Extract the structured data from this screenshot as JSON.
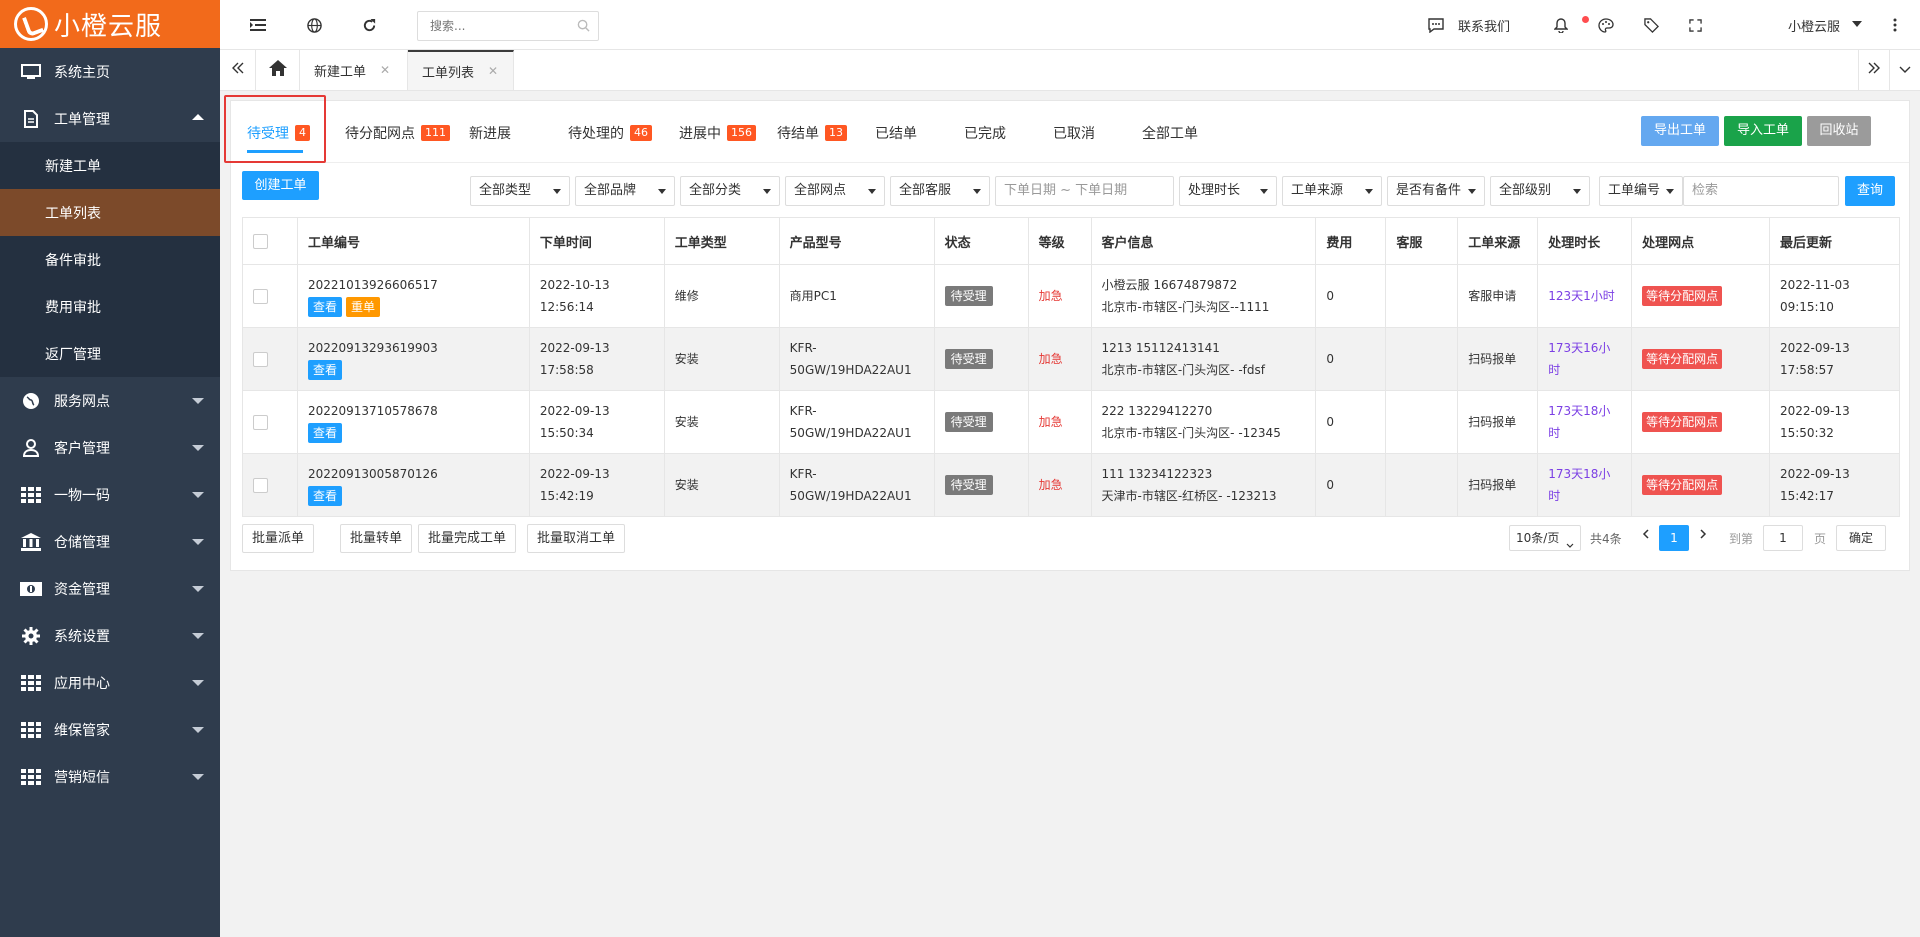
{
  "app": {
    "brand": "小橙云服"
  },
  "sidebar": {
    "items": [
      {
        "label": "系统主页",
        "icon": "monitor-icon"
      },
      {
        "label": "工单管理",
        "icon": "document-icon",
        "open": true,
        "children": [
          "新建工单",
          "工单列表",
          "备件审批",
          "费用审批",
          "返厂管理"
        ],
        "active_child": "工单列表"
      },
      {
        "label": "服务网点",
        "icon": "globe-icon"
      },
      {
        "label": "客户管理",
        "icon": "user-icon"
      },
      {
        "label": "一物一码",
        "icon": "grid-icon"
      },
      {
        "label": "仓储管理",
        "icon": "bank-icon"
      },
      {
        "label": "资金管理",
        "icon": "money-icon"
      },
      {
        "label": "系统设置",
        "icon": "gear-icon"
      },
      {
        "label": "应用中心",
        "icon": "grid-icon"
      },
      {
        "label": "维保管家",
        "icon": "grid-icon"
      },
      {
        "label": "营销短信",
        "icon": "grid-icon"
      }
    ]
  },
  "topbar": {
    "search_placeholder": "搜索...",
    "contact": "联系我们",
    "user": "小橙云服"
  },
  "page_tabs": [
    {
      "label": "新建工单"
    },
    {
      "label": "工单列表",
      "active": true
    }
  ],
  "status_tabs": [
    {
      "label": "待受理",
      "badge": "4",
      "active": true
    },
    {
      "label": "待分配网点",
      "badge": "111"
    },
    {
      "label": "新进展",
      "badge": ""
    },
    {
      "label": "待处理的",
      "badge": "46"
    },
    {
      "label": "进展中",
      "badge": "156"
    },
    {
      "label": "待结单",
      "badge": "13"
    },
    {
      "label": "已结单",
      "badge": ""
    },
    {
      "label": "已完成",
      "badge": ""
    },
    {
      "label": "已取消",
      "badge": ""
    },
    {
      "label": "全部工单",
      "badge": ""
    }
  ],
  "actions": {
    "export": "导出工单",
    "import": "导入工单",
    "recycle": "回收站",
    "create": "创建工单",
    "query": "查询"
  },
  "filters": {
    "type": "全部类型",
    "brand": "全部品牌",
    "category": "全部分类",
    "outlet": "全部网点",
    "service": "全部客服",
    "date_placeholder": "下单日期 ~ 下单日期",
    "duration": "处理时长",
    "source": "工单来源",
    "spare": "是否有备件",
    "level": "全部级别",
    "field": "工单编号",
    "keyword_placeholder": "检索"
  },
  "table": {
    "columns": [
      "工单编号",
      "下单时间",
      "工单类型",
      "产品型号",
      "状态",
      "等级",
      "客户信息",
      "费用",
      "客服",
      "工单来源",
      "处理时长",
      "处理网点",
      "最后更新"
    ],
    "view_label": "查看",
    "rework_label": "重单",
    "rows": [
      {
        "id": "20221013926606517",
        "rework": true,
        "date": "2022-10-13",
        "time": "12:56:14",
        "type": "维修",
        "model": "商用PC1",
        "model2": "",
        "status": "待受理",
        "level": "加急",
        "cust1": "小橙云服 16674879872",
        "cust2": "北京市-市辖区-门头沟区--1111",
        "fee": "0",
        "service": "",
        "source": "客服申请",
        "duration": "123天1小时",
        "duration2": "",
        "outlet": "等待分配网点",
        "upd_date": "2022-11-03",
        "upd_time": "09:15:10"
      },
      {
        "id": "20220913293619903",
        "rework": false,
        "date": "2022-09-13",
        "time": "17:58:58",
        "type": "安装",
        "model": "KFR-",
        "model2": "50GW/19HDA22AU1",
        "status": "待受理",
        "level": "加急",
        "cust1": "1213 15112413141",
        "cust2": "北京市-市辖区-门头沟区- -fdsf",
        "fee": "0",
        "service": "",
        "source": "扫码报单",
        "duration": "173天16小",
        "duration2": "时",
        "outlet": "等待分配网点",
        "upd_date": "2022-09-13",
        "upd_time": "17:58:57"
      },
      {
        "id": "20220913710578678",
        "rework": false,
        "date": "2022-09-13",
        "time": "15:50:34",
        "type": "安装",
        "model": "KFR-",
        "model2": "50GW/19HDA22AU1",
        "status": "待受理",
        "level": "加急",
        "cust1": "222 13229412270",
        "cust2": "北京市-市辖区-门头沟区- -12345",
        "fee": "0",
        "service": "",
        "source": "扫码报单",
        "duration": "173天18小",
        "duration2": "时",
        "outlet": "等待分配网点",
        "upd_date": "2022-09-13",
        "upd_time": "15:50:32"
      },
      {
        "id": "20220913005870126",
        "rework": false,
        "date": "2022-09-13",
        "time": "15:42:19",
        "type": "安装",
        "model": "KFR-",
        "model2": "50GW/19HDA22AU1",
        "status": "待受理",
        "level": "加急",
        "cust1": "111 13234122323",
        "cust2": "天津市-市辖区-红桥区- -123213",
        "fee": "0",
        "service": "",
        "source": "扫码报单",
        "duration": "173天18小",
        "duration2": "时",
        "outlet": "等待分配网点",
        "upd_date": "2022-09-13",
        "upd_time": "15:42:17"
      }
    ]
  },
  "footer": {
    "batch_dispatch": "批量派单",
    "batch_transfer": "批量转单",
    "batch_complete": "批量完成工单",
    "batch_cancel": "批量取消工单",
    "page_size": "10条/页",
    "total": "共4条",
    "current_page": "1",
    "goto_label": "到第",
    "goto_value": "1",
    "page_unit": "页",
    "confirm": "确定"
  },
  "colors": {
    "brand": "#f26a1b",
    "sidebar": "#2f3c4d",
    "accent": "#1e9fff",
    "badge": "#ff5722",
    "urgent": "#e53935"
  }
}
